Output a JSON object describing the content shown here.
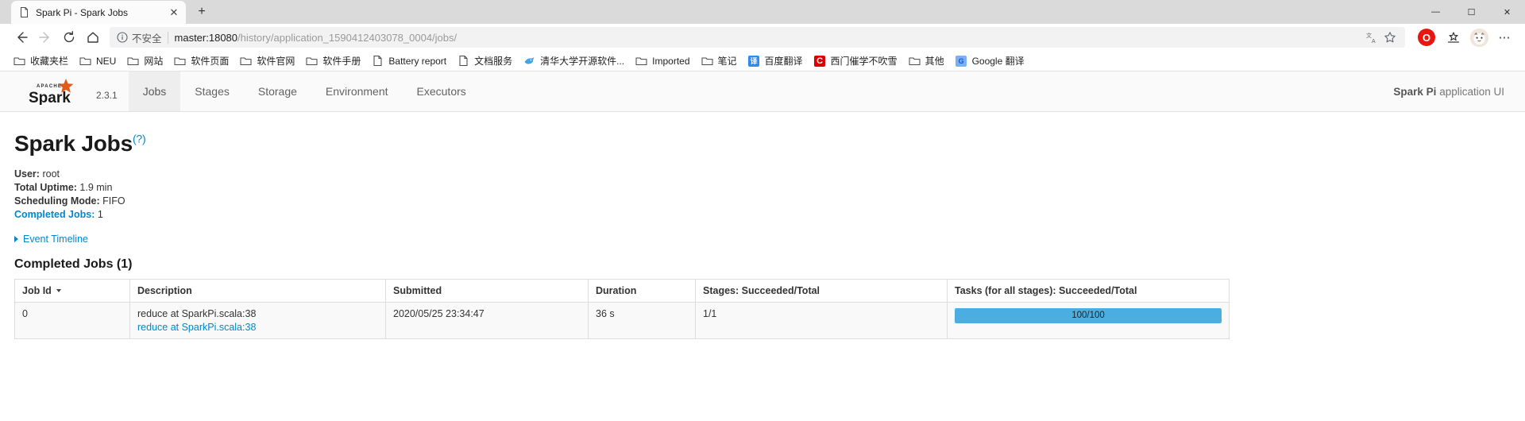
{
  "browser": {
    "tab": {
      "title": "Spark Pi - Spark Jobs",
      "favicon_name": "page-icon",
      "close_label": "✕"
    },
    "new_tab_label": "+",
    "window_controls": {
      "minimize": "—",
      "maximize": "☐",
      "close": "✕"
    },
    "nav": {
      "back": "←",
      "forward": "→",
      "reload": "⟳",
      "home": "⌂"
    },
    "address": {
      "security_label": "不安全",
      "security_icon": "info-circle-icon",
      "url_host": "master:18080",
      "url_path": "/history/application_1590412403078_0004/jobs/",
      "full_url": "master:18080/history/application_1590412403078_0004/jobs/",
      "translate_icon": "translate-icon",
      "bookmark_icon": "star-icon"
    },
    "toolbar_right": {
      "opera_label": "O",
      "collections_icon": "collections-icon",
      "profile_icon": "avatar-icon",
      "menu_icon": "more-options-icon"
    },
    "bookmarks": [
      {
        "label": "收藏夹栏",
        "icon": "folder-icon"
      },
      {
        "label": "NEU",
        "icon": "folder-icon"
      },
      {
        "label": "网站",
        "icon": "folder-icon"
      },
      {
        "label": "软件页面",
        "icon": "folder-icon"
      },
      {
        "label": "软件官网",
        "icon": "folder-icon"
      },
      {
        "label": "软件手册",
        "icon": "folder-icon"
      },
      {
        "label": "Battery report",
        "icon": "page-icon"
      },
      {
        "label": "文档服务",
        "icon": "page-icon"
      },
      {
        "label": "清华大学开源软件...",
        "icon": "tuna-icon",
        "color": "#3ea5e8"
      },
      {
        "label": "Imported",
        "icon": "folder-icon"
      },
      {
        "label": "笔记",
        "icon": "folder-icon"
      },
      {
        "label": "百度翻译",
        "icon": "baidu-translate-icon",
        "glyph": "译",
        "color": "#2d8cf0"
      },
      {
        "label": "西门催学不吹雪",
        "icon": "csdn-icon",
        "glyph": "C",
        "color": "#d80000"
      },
      {
        "label": "其他",
        "icon": "folder-icon"
      },
      {
        "label": "Google 翻译",
        "icon": "google-translate-icon",
        "glyph": "G",
        "color": "#4285f4"
      }
    ]
  },
  "spark": {
    "brand": {
      "apache_text": "APACHE",
      "spark_text": "Spark",
      "version": "2.3.1"
    },
    "tabs": [
      {
        "label": "Jobs",
        "active": true
      },
      {
        "label": "Stages",
        "active": false
      },
      {
        "label": "Storage",
        "active": false
      },
      {
        "label": "Environment",
        "active": false
      },
      {
        "label": "Executors",
        "active": false
      }
    ],
    "app_ui": {
      "name": "Spark Pi",
      "suffix": "application UI"
    },
    "page_title": "Spark Jobs",
    "page_title_help": "(?)",
    "summary": {
      "user_label": "User:",
      "user_value": "root",
      "uptime_label": "Total Uptime:",
      "uptime_value": "1.9 min",
      "scheduling_label": "Scheduling Mode:",
      "scheduling_value": "FIFO",
      "completed_label": "Completed Jobs:",
      "completed_value": "1"
    },
    "event_timeline_label": "Event Timeline",
    "section_title": "Completed Jobs (1)",
    "table": {
      "headers": [
        "Job Id",
        "Description",
        "Submitted",
        "Duration",
        "Stages: Succeeded/Total",
        "Tasks (for all stages): Succeeded/Total"
      ],
      "rows": [
        {
          "job_id": "0",
          "description": "reduce at SparkPi.scala:38",
          "description_link": "reduce at SparkPi.scala:38",
          "submitted": "2020/05/25 23:34:47",
          "duration": "36 s",
          "stages": "1/1",
          "tasks_label": "100/100",
          "tasks_percent": 100
        }
      ]
    },
    "colors": {
      "link": "#0088cc",
      "progress_fill": "#4aaee0",
      "progress_track": "#d6eefa",
      "spark_orange": "#e25a1c"
    }
  }
}
